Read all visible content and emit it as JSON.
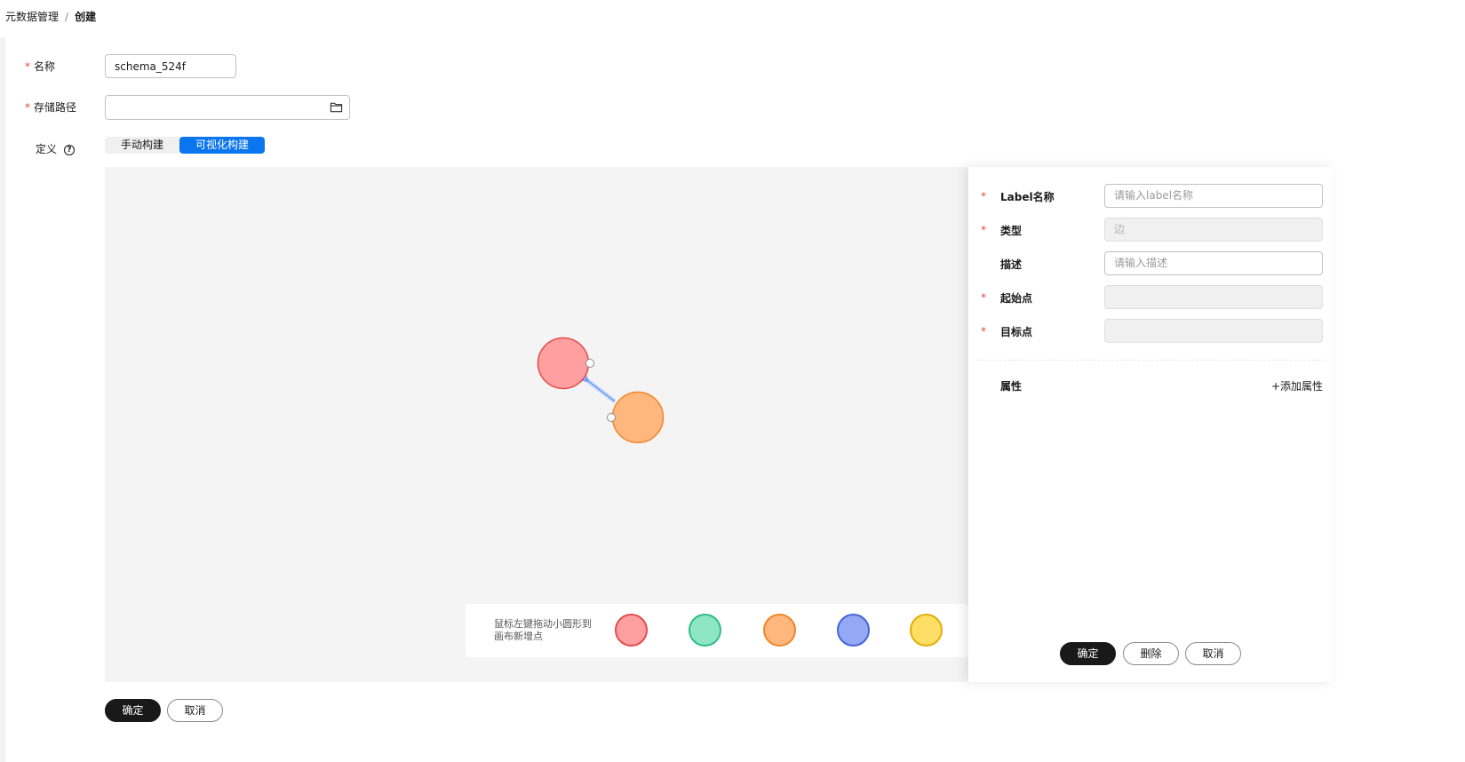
{
  "breadcrumb": {
    "parent": "元数据管理",
    "separator": "/",
    "current": "创建"
  },
  "form": {
    "name_label": "名称",
    "name_value": "schema_524f",
    "path_label": "存储路径",
    "path_value": "",
    "definition_label": "定义",
    "help_glyph": "?",
    "modes": {
      "manual": "手动构建",
      "visual": "可视化构建"
    }
  },
  "palette": {
    "hint": "鼠标左键拖动小圆形到画布新增点",
    "swatches": [
      {
        "fill": "#ff9f9f",
        "stroke": "#e24b4b"
      },
      {
        "fill": "#8ee6c6",
        "stroke": "#2ebd87"
      },
      {
        "fill": "#ffb77d",
        "stroke": "#f08628"
      },
      {
        "fill": "#93a9f5",
        "stroke": "#4565d8"
      },
      {
        "fill": "#ffde66",
        "stroke": "#e3ad09"
      }
    ]
  },
  "graph": {
    "nodes": [
      {
        "id": "n1",
        "fill": "#ff9f9f",
        "stroke": "#e24b4b"
      },
      {
        "id": "n2",
        "fill": "#ffb77d",
        "stroke": "#f08628"
      }
    ],
    "edge_color": "#6a9cf4"
  },
  "panel": {
    "label_name": {
      "label": "Label名称",
      "placeholder": "请输入label名称"
    },
    "type": {
      "label": "类型",
      "value": "边"
    },
    "description": {
      "label": "描述",
      "placeholder": "请输入描述"
    },
    "source": {
      "label": "起始点",
      "value": ""
    },
    "target": {
      "label": "目标点",
      "value": ""
    },
    "properties_label": "属性",
    "add_property": "+添加属性",
    "confirm": "确定",
    "delete": "删除",
    "cancel": "取消"
  },
  "footer": {
    "confirm": "确定",
    "cancel": "取消"
  },
  "colors": {
    "accent": "#0b75f0",
    "required": "#e54545",
    "primary_button": "#191919"
  }
}
